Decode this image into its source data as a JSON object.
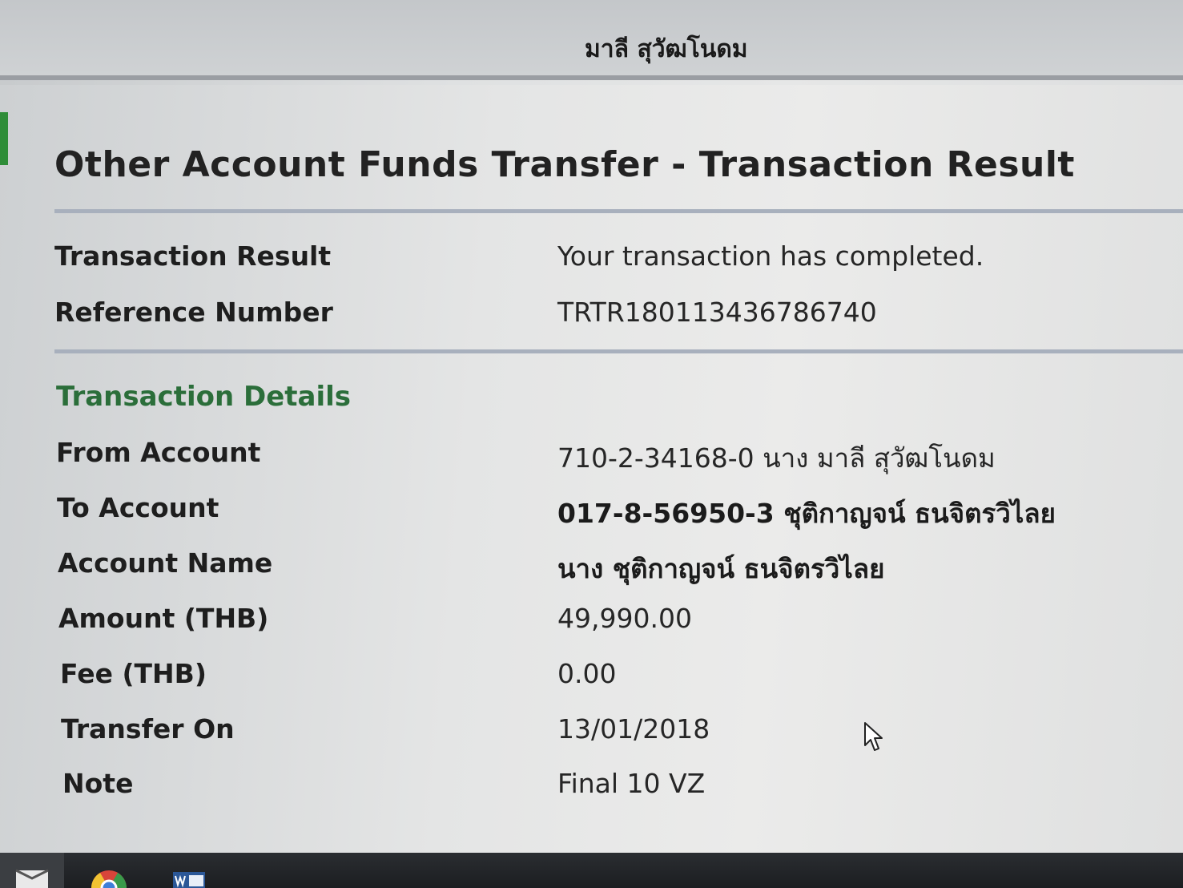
{
  "header": {
    "user_name": "มาลี สุวัฒโนดม"
  },
  "page": {
    "title": "Other Account Funds Transfer - Transaction Result"
  },
  "result": {
    "rows": [
      {
        "label": "Transaction Result",
        "value": "Your transaction has completed."
      },
      {
        "label": "Reference Number",
        "value": "TRTR180113436786740"
      }
    ]
  },
  "details": {
    "heading": "Transaction Details",
    "rows": [
      {
        "label": "From Account",
        "value": "710-2-34168-0 นาง มาลี สุวัฒโนดม"
      },
      {
        "label": "To Account",
        "value": "017-8-56950-3 ชุติกาญจน์ ธนจิตรวิไลย"
      },
      {
        "label": "Account Name",
        "value": "นาง ชุติกาญจน์ ธนจิตรวิไลย"
      },
      {
        "label": "Amount (THB)",
        "value": "49,990.00"
      },
      {
        "label": "Fee (THB)",
        "value": "0.00"
      },
      {
        "label": "Transfer On",
        "value": "13/01/2018"
      },
      {
        "label": "Note",
        "value": "Final 10 VZ"
      }
    ]
  },
  "colors": {
    "section_heading": "#2b6e3a",
    "accent": "#2f8d38",
    "divider": "#a8b0bd"
  },
  "taskbar": {
    "icons": [
      "start-icon",
      "chrome-icon",
      "word-icon"
    ]
  }
}
